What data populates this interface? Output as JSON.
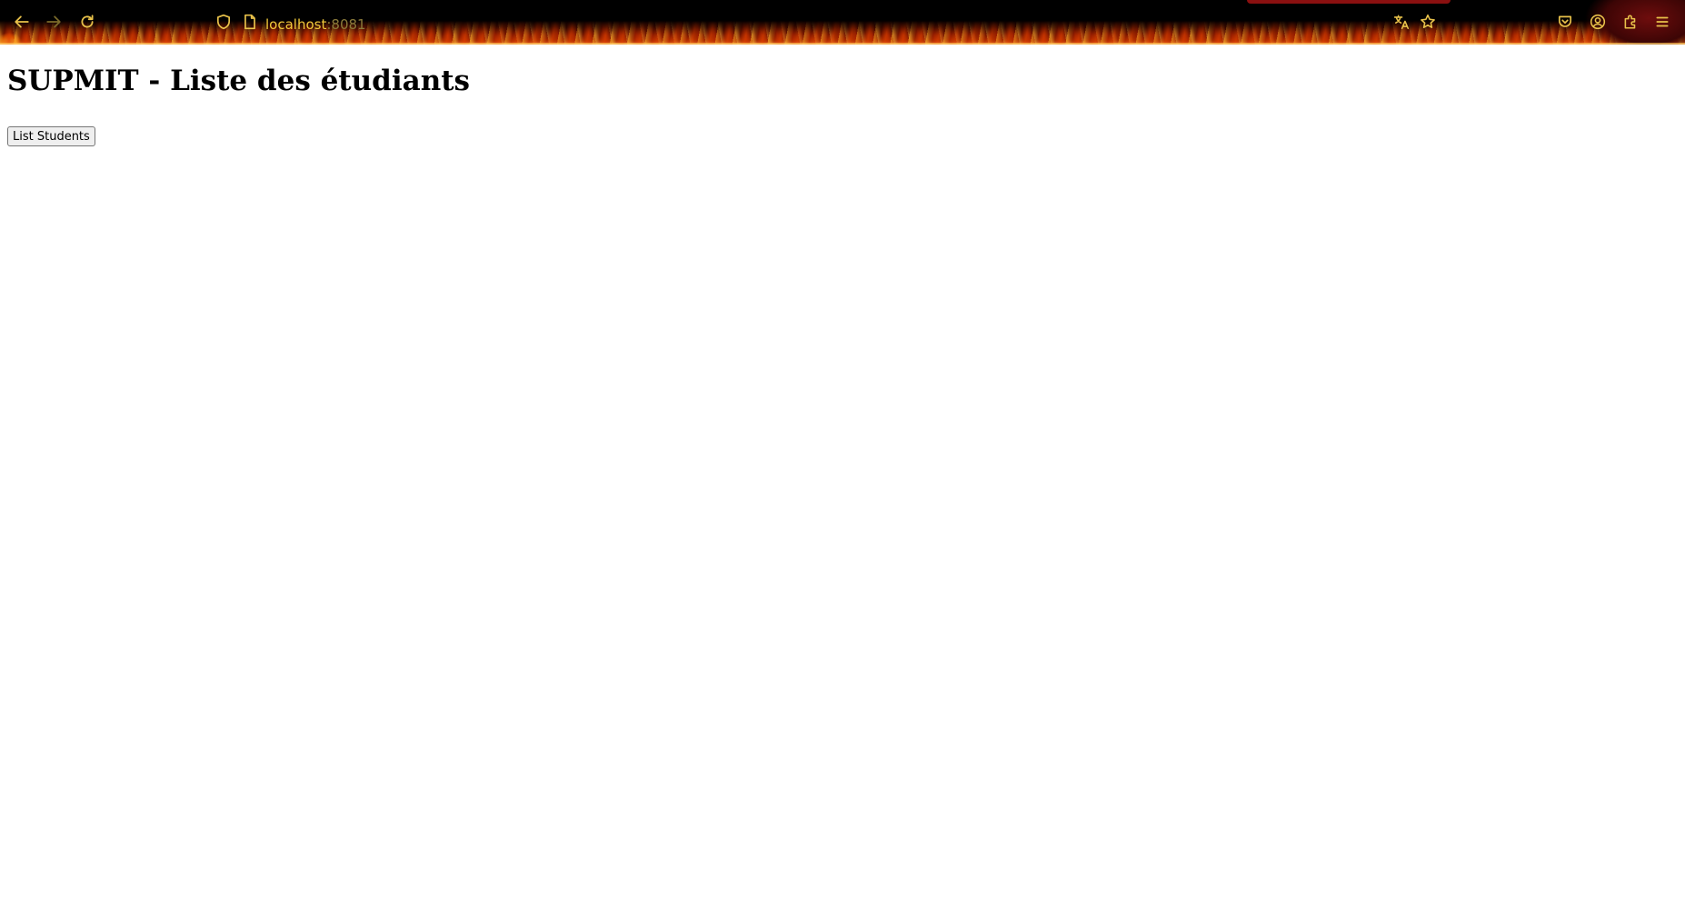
{
  "browser": {
    "url_host": "localhost",
    "url_port": ":8081",
    "theme_colors": {
      "icon": "#e8c14a",
      "toolbar_top": "#000000",
      "flame_orange": "#d2561a",
      "flame_red": "#6e1300"
    },
    "icons": {
      "back": "arrow-left",
      "forward": "arrow-right",
      "reload": "reload",
      "tracking_protection": "shield",
      "page_info": "document",
      "translate": "translate",
      "bookmark": "star",
      "pocket": "pocket",
      "account": "account-circle",
      "extensions": "puzzle",
      "menu": "hamburger"
    }
  },
  "page": {
    "title": "SUPMIT - Liste des étudiants",
    "list_button_label": "List Students"
  }
}
